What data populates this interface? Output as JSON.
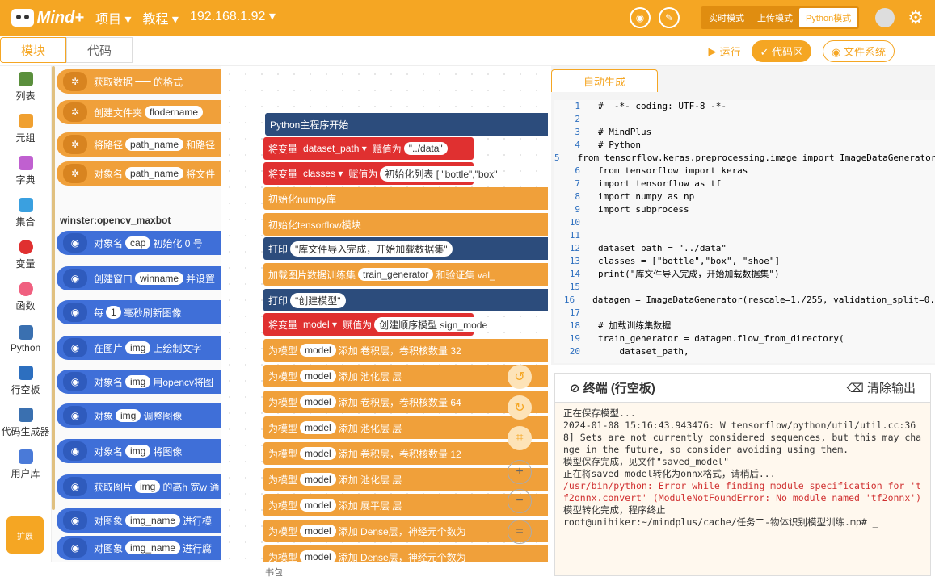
{
  "topbar": {
    "logo": "Mind+",
    "menu": [
      "项目 ▾",
      "教程 ▾",
      "192.168.1.92 ▾"
    ],
    "modes": [
      "实时模式",
      "上传模式",
      "Python模式"
    ],
    "active_mode": "Python模式"
  },
  "subbar": {
    "tabs": [
      "模块",
      "代码"
    ],
    "run": "运行",
    "code_area": "代码区",
    "file_system": "文件系统"
  },
  "sidebar": {
    "items": [
      {
        "label": "列表",
        "color": "#5a8f3c"
      },
      {
        "label": "元组",
        "color": "#f0a030"
      },
      {
        "label": "字典",
        "color": "#c060d0"
      },
      {
        "label": "集合",
        "color": "#3aa0e0"
      },
      {
        "label": "变量",
        "color": "#e03030"
      },
      {
        "label": "函数",
        "color": "#f06080"
      },
      {
        "label": "Python",
        "color": "#3a70b0"
      },
      {
        "label": "行空板",
        "color": "#2d6fbf"
      },
      {
        "label": "代码生成器",
        "color": "#3a70b0"
      },
      {
        "label": "用户库",
        "color": "#4a7ad8"
      }
    ],
    "expand": "扩展"
  },
  "palette": {
    "header": "winster:opencv_maxbot",
    "blocks": [
      {
        "text": "获取数据",
        "pill": "",
        "rest": "的格式",
        "color": "orange"
      },
      {
        "text": "创建文件夹",
        "pill": "flodername",
        "rest": "",
        "color": "orange"
      },
      {
        "text": "将路径",
        "pill": "path_name",
        "rest": "和路径",
        "color": "orange"
      },
      {
        "text": "对象名",
        "pill": "path_name",
        "rest": "将文件",
        "color": "orange"
      },
      {
        "text": "对象名",
        "pill": "cap",
        "rest": "初始化 0 号",
        "color": "blue"
      },
      {
        "text": "创建窗口",
        "pill": "winname",
        "rest": "并设置",
        "color": "blue"
      },
      {
        "text": "每",
        "pill": "1",
        "rest": "毫秒刷新图像",
        "color": "blue"
      },
      {
        "text": "在图片",
        "pill": "img",
        "rest": "上绘制文字",
        "color": "blue"
      },
      {
        "text": "对象名",
        "pill": "img",
        "rest": "用opencv将图",
        "color": "blue"
      },
      {
        "text": "对象",
        "pill": "img",
        "rest": "调整图像",
        "color": "blue"
      },
      {
        "text": "对象名",
        "pill": "img",
        "rest": "将图像",
        "color": "blue"
      },
      {
        "text": "获取图片",
        "pill": "img",
        "rest": "的高h 宽w 通",
        "color": "blue"
      },
      {
        "text": "对图象",
        "pill": "img_name",
        "rest": "进行模",
        "color": "blue"
      },
      {
        "text": "对图象",
        "pill": "img_name",
        "rest": "进行腐",
        "color": "blue"
      }
    ]
  },
  "canvas": {
    "blocks": [
      {
        "type": "dark",
        "text": "Python主程序开始"
      },
      {
        "type": "red",
        "text": "将变量",
        "var": "dataset_path",
        "mid": "赋值为",
        "val": "\"../data\""
      },
      {
        "type": "red",
        "text": "将变量",
        "var": "classes",
        "mid": "赋值为",
        "val": "初始化列表 [ \"bottle\",\"box\""
      },
      {
        "type": "orange",
        "text": "初始化numpy库"
      },
      {
        "type": "orange",
        "text": "初始化tensorflow模块"
      },
      {
        "type": "dark",
        "text": "打印",
        "val": "\"库文件导入完成，开始加载数据集\""
      },
      {
        "type": "orange",
        "text": "加载图片数据训练集",
        "val": "train_generator",
        "rest": "和验证集 val_"
      },
      {
        "type": "dark",
        "text": "打印",
        "val": "\"创建模型\""
      },
      {
        "type": "red",
        "text": "将变量",
        "var": "model",
        "mid": "赋值为",
        "val": "创建顺序模型 sign_mode"
      },
      {
        "type": "orange",
        "text": "为模型",
        "val": "model",
        "rest": "添加  卷积层，卷积核数量 32"
      },
      {
        "type": "orange",
        "text": "为模型",
        "val": "model",
        "rest": "添加  池化层 层"
      },
      {
        "type": "orange",
        "text": "为模型",
        "val": "model",
        "rest": "添加  卷积层，卷积核数量 64"
      },
      {
        "type": "orange",
        "text": "为模型",
        "val": "model",
        "rest": "添加  池化层 层"
      },
      {
        "type": "orange",
        "text": "为模型",
        "val": "model",
        "rest": "添加  卷积层，卷积核数量 12"
      },
      {
        "type": "orange",
        "text": "为模型",
        "val": "model",
        "rest": "添加  池化层 层"
      },
      {
        "type": "orange",
        "text": "为模型",
        "val": "model",
        "rest": "添加  展平层 层"
      },
      {
        "type": "orange",
        "text": "为模型",
        "val": "model",
        "rest": "添加  Dense层，神经元个数为"
      },
      {
        "type": "orange",
        "text": "为模型",
        "val": "model",
        "rest": "添加  Dense层，神经元个数为"
      }
    ]
  },
  "bottom": "书包",
  "code": {
    "tab": "自动生成",
    "lines": [
      "#  -*- coding: UTF-8 -*-",
      "",
      "# MindPlus",
      "# Python",
      "from tensorflow.keras.preprocessing.image import ImageDataGenerator",
      "from tensorflow import keras",
      "import tensorflow as tf",
      "import numpy as np",
      "import subprocess",
      "",
      "",
      "dataset_path = \"../data\"",
      "classes = [\"bottle\",\"box\", \"shoe\"]",
      "print(\"库文件导入完成，开始加载数据集\")",
      "",
      "datagen = ImageDataGenerator(rescale=1./255, validation_split=0.",
      "",
      "# 加载训练集数据",
      "train_generator = datagen.flow_from_directory(",
      "    dataset_path,"
    ]
  },
  "terminal": {
    "title": "终端 (行空板)",
    "clear": "清除输出",
    "lines": [
      {
        "t": "正在保存模型...",
        "e": false
      },
      {
        "t": "2024-01-08 15:16:43.943476: W tensorflow/python/util/util.cc:368] Sets are not currently considered sequences, but this may change in the future, so consider avoiding using them.",
        "e": false
      },
      {
        "t": "模型保存完成，见文件\"saved_model\"",
        "e": false
      },
      {
        "t": "正在将saved_model转化为onnx格式，请稍后...",
        "e": false
      },
      {
        "t": "/usr/bin/python: Error while finding module specification for 'tf2onnx.convert' (ModuleNotFoundError: No module named 'tf2onnx')",
        "e": true
      },
      {
        "t": "模型转化完成，程序终止",
        "e": false
      },
      {
        "t": "root@unihiker:~/mindplus/cache/任务二-物体识别模型训练.mp# _",
        "e": false
      }
    ]
  }
}
